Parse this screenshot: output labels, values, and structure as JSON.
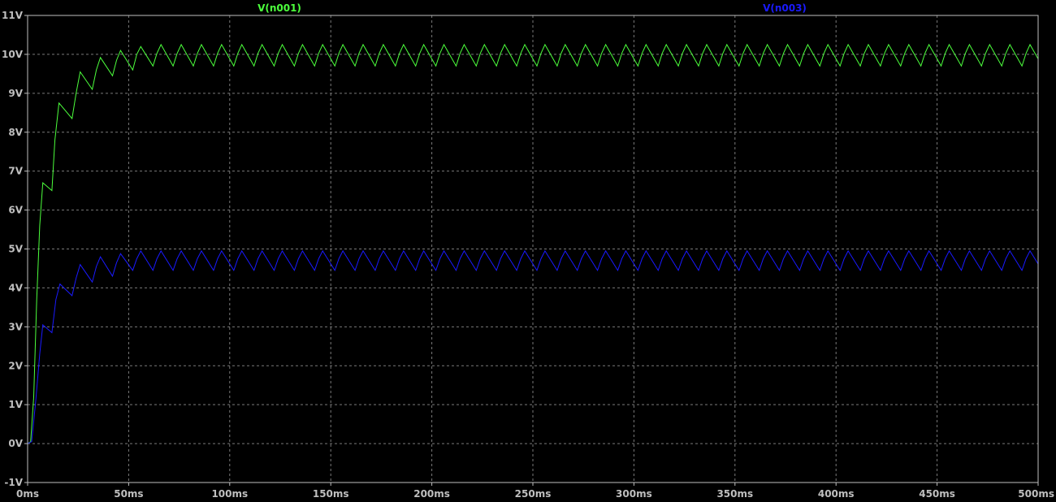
{
  "chart_data": {
    "type": "line",
    "title": "",
    "xlabel": "",
    "ylabel": "",
    "xlim": [
      0,
      500
    ],
    "ylim": [
      -1,
      11
    ],
    "x_ticks": [
      "0ms",
      "50ms",
      "100ms",
      "150ms",
      "200ms",
      "250ms",
      "300ms",
      "350ms",
      "400ms",
      "450ms",
      "500ms"
    ],
    "y_ticks": [
      "-1V",
      "0V",
      "1V",
      "2V",
      "3V",
      "4V",
      "5V",
      "6V",
      "7V",
      "8V",
      "9V",
      "10V",
      "11V"
    ],
    "grid": true,
    "legend_placement": "top",
    "colors": {
      "background": "#000000",
      "grid": "#7a7a7a",
      "axis": "#bfbfbf",
      "tick_text": "#bfbfbf"
    },
    "series": [
      {
        "name": "V(n001)",
        "color": "#4cff3c",
        "start": [
          [
            0,
            0
          ],
          [
            1.5,
            0.05
          ],
          [
            3,
            1.2
          ],
          [
            4.5,
            3.7
          ],
          [
            6,
            5.6
          ],
          [
            7.5,
            6.7
          ],
          [
            12,
            6.5
          ],
          [
            13.5,
            7.8
          ],
          [
            15.5,
            8.75
          ],
          [
            22,
            8.35
          ],
          [
            24,
            9.0
          ],
          [
            26,
            9.55
          ],
          [
            32,
            9.1
          ],
          [
            34,
            9.6
          ],
          [
            36,
            9.92
          ],
          [
            42,
            9.45
          ],
          [
            44,
            9.85
          ],
          [
            46,
            10.1
          ],
          [
            52,
            9.6
          ],
          [
            54,
            10.0
          ],
          [
            56,
            10.2
          ]
        ],
        "steady_period_ms": 10,
        "steady_peak": 10.25,
        "steady_trough": 9.7,
        "steady_phase_ms": 56
      },
      {
        "name": "V(n003)",
        "color": "#1a1aff",
        "start": [
          [
            0,
            0
          ],
          [
            2,
            0.05
          ],
          [
            4,
            1.1
          ],
          [
            6,
            2.3
          ],
          [
            7.5,
            3.05
          ],
          [
            12,
            2.85
          ],
          [
            14,
            3.7
          ],
          [
            16,
            4.1
          ],
          [
            22,
            3.8
          ],
          [
            24,
            4.25
          ],
          [
            26,
            4.6
          ],
          [
            32,
            4.15
          ],
          [
            34,
            4.55
          ],
          [
            36,
            4.8
          ],
          [
            42,
            4.3
          ],
          [
            44,
            4.65
          ],
          [
            46,
            4.88
          ],
          [
            52,
            4.45
          ],
          [
            54,
            4.75
          ],
          [
            56,
            4.95
          ]
        ],
        "steady_period_ms": 10,
        "steady_peak": 4.95,
        "steady_trough": 4.45,
        "steady_phase_ms": 56
      }
    ]
  }
}
